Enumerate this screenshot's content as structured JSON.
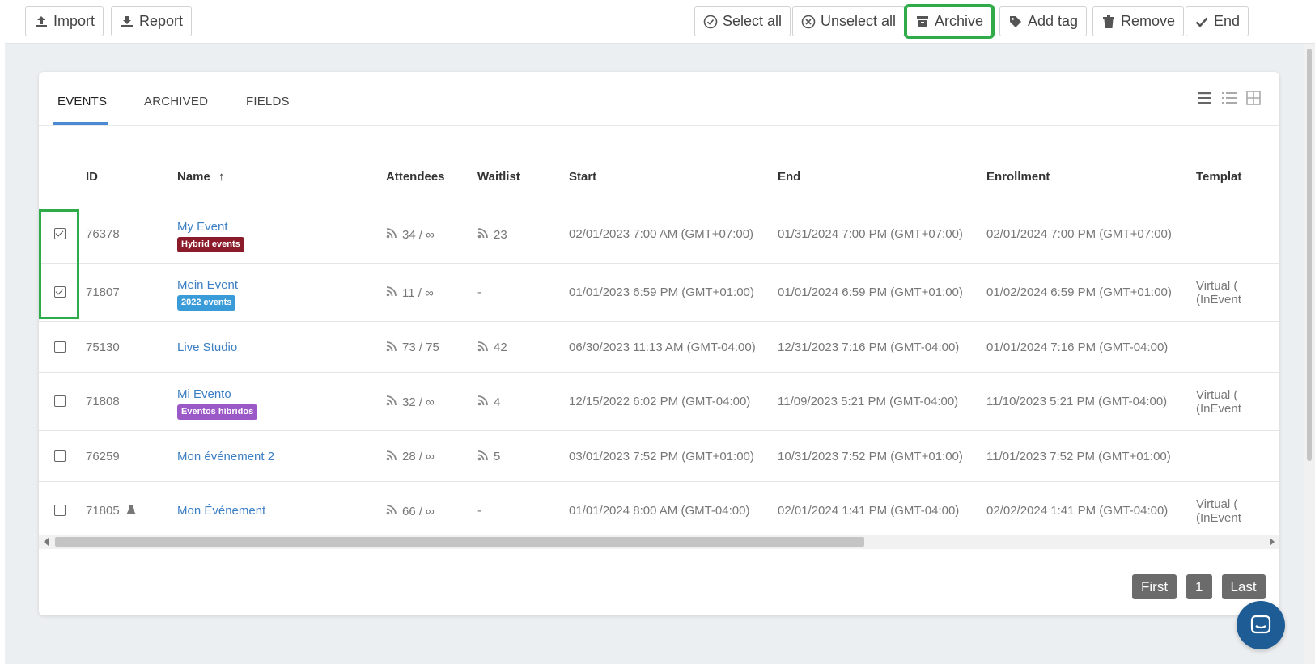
{
  "toolbar": {
    "import_label": "Import",
    "report_label": "Report",
    "select_all_label": "Select all",
    "unselect_all_label": "Unselect all",
    "archive_label": "Archive",
    "add_tag_label": "Add tag",
    "remove_label": "Remove",
    "end_label": "End"
  },
  "tabs": [
    {
      "label": "EVENTS",
      "active": true
    },
    {
      "label": "ARCHIVED",
      "active": false
    },
    {
      "label": "FIELDS",
      "active": false
    }
  ],
  "table": {
    "headers": {
      "id": "ID",
      "name": "Name",
      "name_sort_icon": "↑",
      "attendees": "Attendees",
      "waitlist": "Waitlist",
      "start": "Start",
      "end": "End",
      "enrollment": "Enrollment",
      "template": "Templat"
    },
    "rows": [
      {
        "checked": true,
        "id": "76378",
        "name": "My Event",
        "tag": "Hybrid events",
        "tag_color": "#8b1a2b",
        "attendees": "34 / ∞",
        "waitlist": "23",
        "waitlist_icon": true,
        "start": "02/01/2023 7:00 AM (GMT+07:00)",
        "end": "01/31/2024 7:00 PM (GMT+07:00)",
        "enrollment": "02/01/2024 7:00 PM (GMT+07:00)",
        "template_1": "",
        "template_2": ""
      },
      {
        "checked": true,
        "id": "71807",
        "name": "Mein Event",
        "tag": "2022 events",
        "tag_color": "#3a9bd9",
        "attendees": "11 / ∞",
        "waitlist": "-",
        "waitlist_icon": false,
        "start": "01/01/2023 6:59 PM (GMT+01:00)",
        "end": "01/01/2024 6:59 PM (GMT+01:00)",
        "enrollment": "01/02/2024 6:59 PM (GMT+01:00)",
        "template_1": "Virtual (",
        "template_2": "(InEvent"
      },
      {
        "checked": false,
        "id": "75130",
        "name": "Live Studio",
        "tag": "",
        "tag_color": "",
        "attendees": "73 / 75",
        "waitlist": "42",
        "waitlist_icon": true,
        "start": "06/30/2023 11:13 AM (GMT-04:00)",
        "end": "12/31/2023 7:16 PM (GMT-04:00)",
        "enrollment": "01/01/2024 7:16 PM (GMT-04:00)",
        "template_1": "",
        "template_2": ""
      },
      {
        "checked": false,
        "id": "71808",
        "name": "Mi Evento",
        "tag": "Eventos híbridos",
        "tag_color": "#9b59c8",
        "attendees": "32 / ∞",
        "waitlist": "4",
        "waitlist_icon": true,
        "start": "12/15/2022 6:02 PM (GMT-04:00)",
        "end": "11/09/2023 5:21 PM (GMT-04:00)",
        "enrollment": "11/10/2023 5:21 PM (GMT-04:00)",
        "template_1": "Virtual (",
        "template_2": "(InEvent"
      },
      {
        "checked": false,
        "id": "76259",
        "name": "Mon événement 2",
        "tag": "",
        "tag_color": "",
        "attendees": "28 / ∞",
        "waitlist": "5",
        "waitlist_icon": true,
        "start": "03/01/2023 7:52 PM (GMT+01:00)",
        "end": "10/31/2023 7:52 PM (GMT+01:00)",
        "enrollment": "11/01/2023 7:52 PM (GMT+01:00)",
        "template_1": "",
        "template_2": ""
      },
      {
        "checked": false,
        "id": "71805",
        "name": "Mon Événement",
        "tag": "",
        "tag_color": "",
        "attendees": "66 / ∞",
        "waitlist": "-",
        "waitlist_icon": false,
        "start": "01/01/2024 8:00 AM (GMT-04:00)",
        "end": "02/01/2024 1:41 PM (GMT-04:00)",
        "enrollment": "02/02/2024 1:41 PM (GMT-04:00)",
        "template_1": "Virtual (",
        "template_2": "(InEvent",
        "flask_icon": true
      }
    ]
  },
  "pagination": {
    "first_label": "First",
    "page_label": "1",
    "last_label": "Last"
  },
  "colors": {
    "accent": "#4a8ad4",
    "link": "#3c7fc4",
    "highlight": "#2fab4a",
    "chat_bubble": "#1e5c95"
  }
}
